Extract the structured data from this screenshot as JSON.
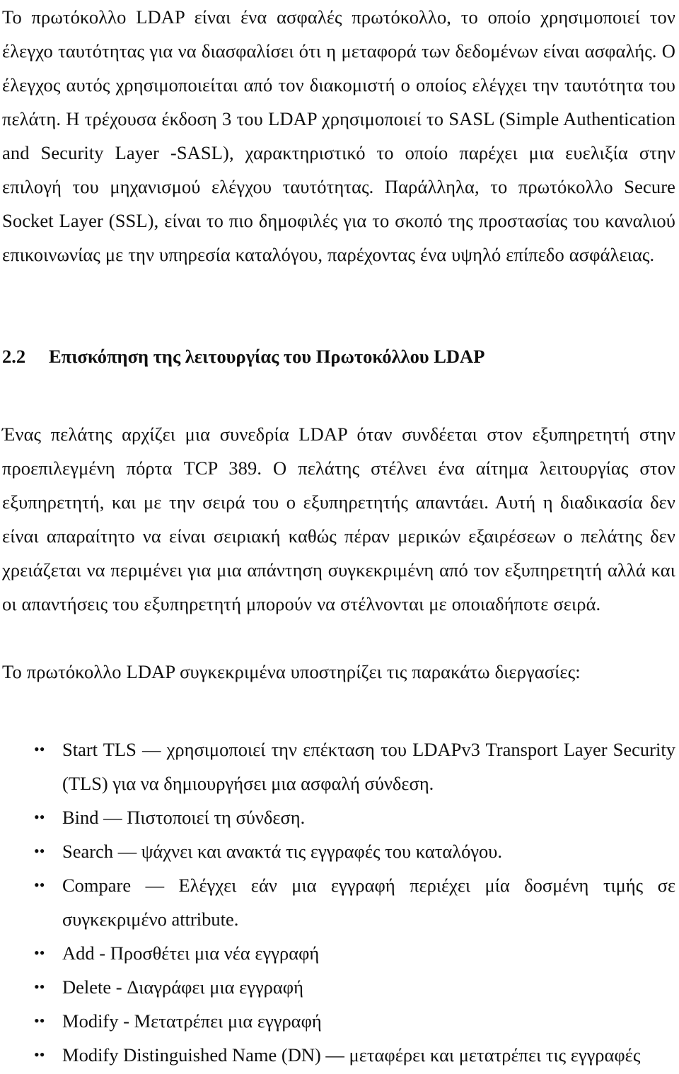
{
  "document": {
    "language": "el",
    "paragraphs": {
      "p1": "Το πρωτόκολλο LDAP είναι ένα ασφαλές πρωτόκολλο, το οποίο χρησιμοποιεί τον έλεγχο ταυτότητας για να διασφαλίσει ότι η μεταφορά των δεδομένων είναι ασφαλής. Ο έλεγχος αυτός χρησιμοποιείται από τον διακομιστή ο οποίος ελέγχει την ταυτότητα του πελάτη. Η τρέχουσα έκδοση 3 του LDAP χρησιμοποιεί το SASL (Simple Authentication and Security Layer -SASL), χαρακτηριστικό το οποίο παρέχει μια ευελιξία στην επιλογή του μηχανισμού ελέγχου ταυτότητας. Παράλληλα, το πρωτόκολλο Secure Socket Layer (SSL), είναι το πιο δημοφιλές για το σκοπό της προστασίας του καναλιού επικοινωνίας με την υπηρεσία καταλόγου, παρέχοντας ένα υψηλό επίπεδο ασφάλειας.",
      "p2": "Ένας πελάτης αρχίζει μια συνεδρία LDAP όταν συνδέεται στον εξυπηρετητή στην προεπιλεγμένη πόρτα TCP 389. Ο πελάτης στέλνει ένα αίτημα λειτουργίας στον εξυπηρετητή, και με την σειρά του ο εξυπηρετητής απαντάει. Αυτή η διαδικασία δεν είναι απαραίτητο να είναι σειριακή καθώς πέραν μερικών εξαιρέσεων ο πελάτης δεν χρειάζεται να περιμένει για μια απάντηση συγκεκριμένη από τον εξυπηρετητή αλλά και οι απαντήσεις του εξυπηρετητή μπορούν να στέλνονται με οποιαδήποτε σειρά.",
      "p3": "Το πρωτόκολλο LDAP συγκεκριμένα υποστηρίζει τις παρακάτω διεργασίες:"
    },
    "heading": {
      "number": "2.2",
      "title": "Επισκόπηση της λειτουργίας του Πρωτοκόλλου LDAP"
    },
    "bullet_glyph": "•",
    "operations_list": [
      {
        "text": "Start TLS — χρησιμοποιεί την επέκταση του LDAPv3 Transport Layer Security (TLS) για να δημιουργήσει μια ασφαλή σύνδεση."
      },
      {
        "text": "Bind — Πιστοποιεί τη σύνδεση."
      },
      {
        "text": "Search — ψάχνει και ανακτά τις εγγραφές του καταλόγου."
      },
      {
        "text": "Compare — Ελέγχει εάν μια εγγραφή περιέχει μία δοσμένη τιμής σε συγκεκριμένο attribute."
      },
      {
        "text": "Add - Προσθέτει μια νέα εγγραφή"
      },
      {
        "text": "Delete - Διαγράφει μια εγγραφή"
      },
      {
        "text": "Modify - Μετατρέπει μια εγγραφή"
      },
      {
        "text": "Modify Distinguished Name (DN) — μεταφέρει και μετατρέπει τις εγγραφές"
      }
    ]
  }
}
